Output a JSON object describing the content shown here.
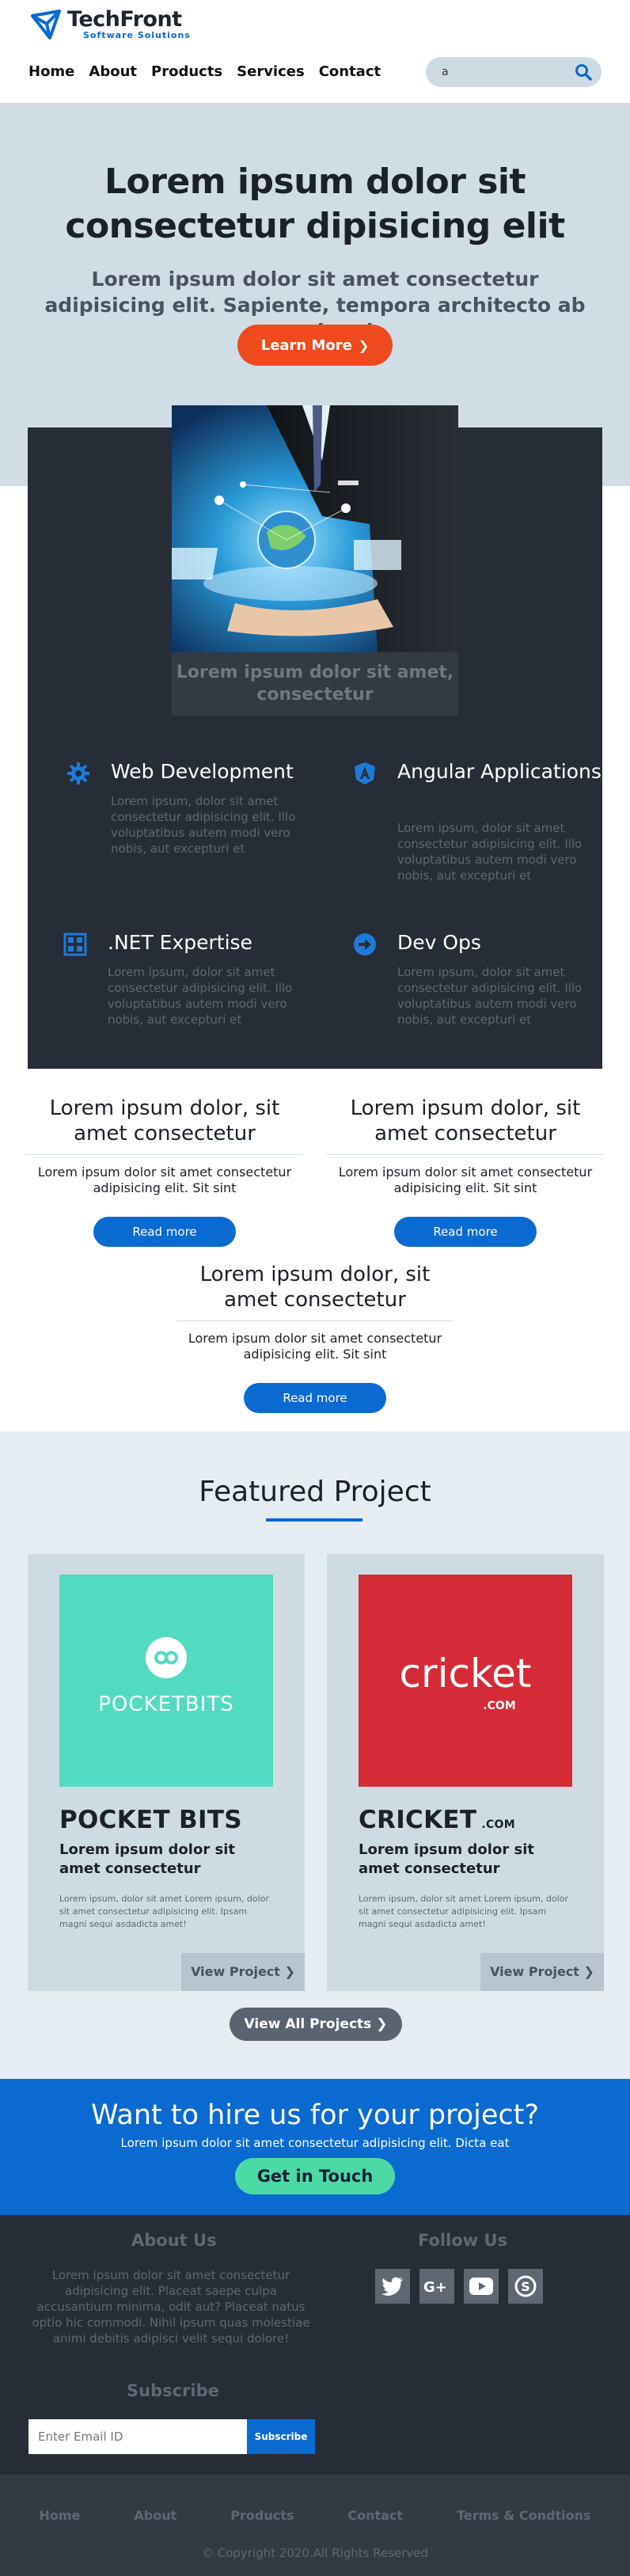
{
  "header": {
    "logo_title": "TechFront",
    "logo_sub": "Software Solutions",
    "nav": [
      "Home",
      "About",
      "Products",
      "Services",
      "Contact"
    ],
    "search_value": "a"
  },
  "hero": {
    "title": "Lorem ipsum dolor sit consectetur dipisicing elit",
    "subtitle": "Lorem ipsum dolor sit amet consectetur adipisicing elit. Sapiente, tempora architecto ab reprehend",
    "cta": "Learn More"
  },
  "feature_caption": "Lorem ipsum dolor sit amet, consectetur",
  "services": [
    {
      "title": "Web Development",
      "icon": "gear-icon",
      "text": "Lorem ipsum, dolor sit amet consectetur adipisicing elit. Illo voluptatibus autem modi vero nobis, aut excepturi et"
    },
    {
      "title": "Angular Applications",
      "icon": "angular-icon",
      "text": "Lorem ipsum, dolor sit amet consectetur adipisicing elit. Illo voluptatibus autem modi vero nobis, aut excepturi et"
    },
    {
      "title": ".NET Expertise",
      "icon": "grid-icon",
      "text": "Lorem ipsum, dolor sit amet consectetur adipisicing elit. Illo voluptatibus autem modi vero nobis, aut excepturi et"
    },
    {
      "title": "Dev Ops",
      "icon": "arrow-circle-icon",
      "text": "Lorem ipsum, dolor sit amet consectetur adipisicing elit. Illo voluptatibus autem modi vero nobis, aut excepturi et"
    }
  ],
  "cards": [
    {
      "title": "Lorem ipsum dolor, sit amet consectetur",
      "text": "Lorem ipsum dolor sit amet consectetur adipisicing elit. Sit sint",
      "button": "Read more"
    },
    {
      "title": "Lorem ipsum dolor, sit amet consectetur",
      "text": "Lorem ipsum dolor sit amet consectetur adipisicing elit. Sit sint",
      "button": "Read more"
    },
    {
      "title": "Lorem ipsum dolor, sit amet consectetur",
      "text": "Lorem ipsum dolor sit amet consectetur adipisicing elit. Sit sint",
      "button": "Read more"
    }
  ],
  "featured": {
    "title": "Featured Project",
    "projects": [
      {
        "name": "POCKET BITS",
        "suffix": "",
        "logo_text": "POCKETBITS",
        "subtitle": "Lorem ipsum dolor sit amet consectetur",
        "desc": "Lorem ipsum, dolor sit amet Lorem ipsum, dolor sit amet consectetur adipisicing elit. Ipsam magni sequi asdadicta amet!",
        "button": "View Project",
        "color": "#52dbc0"
      },
      {
        "name": "CRICKET",
        "suffix": ".COM",
        "logo_text": "cricket",
        "logo_sub": ".COM",
        "subtitle": "Lorem ipsum dolor sit amet consectetur",
        "desc": "Lorem ipsum, dolor sit amet Lorem ipsum, dolor sit amet consectetur adipisicing elit. Ipsam magni sequi asdadicta amet!",
        "button": "View Project",
        "color": "#d52b37"
      }
    ],
    "all_button": "View All Projects"
  },
  "hire": {
    "title": "Want to hire us for your project?",
    "text": "Lorem ipsum dolor sit amet consectetur adipisicing elit. Dicta eat",
    "button": "Get in Touch"
  },
  "footer": {
    "about_title": "About Us",
    "about_text": "Lorem ipsum dolor sit amet consectetur adipisicing elit. Placeat saepe culpa accusantium minima, odit aut? Placeat natus optio hic commodi. Nihil ipsum quas molestiae animi debitis adipisci velit sequi dolore!",
    "follow_title": "Follow Us",
    "social": [
      "twitter-icon",
      "google-plus-icon",
      "youtube-icon",
      "skype-icon"
    ],
    "subscribe_title": "Subscribe",
    "email_placeholder": "Enter Email ID",
    "subscribe_button": "Subscribe",
    "links": [
      "Home",
      "About",
      "Products",
      "Contact",
      "Terms & Condtions"
    ],
    "copyright": "© Copyright 2020.All Rights Reserved"
  }
}
